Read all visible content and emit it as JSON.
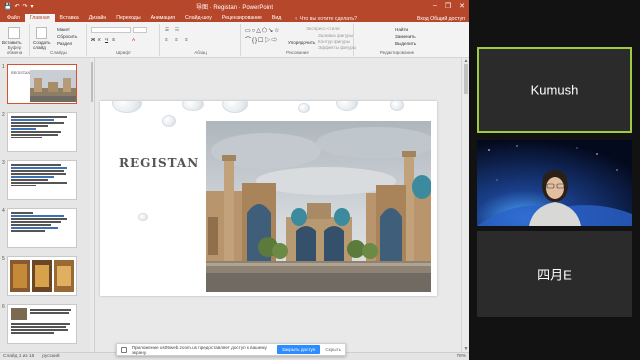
{
  "window": {
    "title": "导图 · Registan · PowerPoint",
    "minimize": "–",
    "maximize": "❐",
    "close": "✕"
  },
  "qat": [
    "💾",
    "↶",
    "↷",
    "▾"
  ],
  "tabs": [
    "Файл",
    "Главная",
    "Вставка",
    "Дизайн",
    "Переходы",
    "Анимация",
    "Слайд-шоу",
    "Рецензирование",
    "Вид"
  ],
  "active_tab": "Главная",
  "tell_me": "♀ Что вы хотите сделать?",
  "user": "Вход",
  "share_label": "Общий доступ",
  "ribbon": {
    "clipboard": {
      "paste": "Вставить",
      "label": "Буфер обмена"
    },
    "slides": {
      "create": "Создать слайд",
      "layout": "Макет",
      "reset": "Сбросить",
      "section": "Раздел",
      "label": "Слайды"
    },
    "font": {
      "label": "Шрифт"
    },
    "paragraph": {
      "label": "Абзац"
    },
    "drawing": {
      "arrange": "Упорядочить",
      "styles": "Экспресс-стили",
      "fill": "Заливка фигуры",
      "outline": "Контур фигуры",
      "effects": "Эффекты фигуры",
      "label": "Рисование"
    },
    "editing": {
      "find": "Найти",
      "replace": "Заменить",
      "select": "Выделить",
      "label": "Редактирование"
    }
  },
  "thumbnails": [
    {
      "num": "1",
      "title": "REGISTAN"
    },
    {
      "num": "2"
    },
    {
      "num": "3"
    },
    {
      "num": "4"
    },
    {
      "num": "5"
    },
    {
      "num": "6"
    }
  ],
  "slide": {
    "title": "REGISTAN"
  },
  "status": {
    "slide": "Слайд 1 из 16",
    "language": "русский",
    "zoom": "78%"
  },
  "share_notice": {
    "text": "Приложение us05web.zoom.us предоставляет доступ к вашему экрану.",
    "stop_label": "Закрыть доступ",
    "hide_label": "Скрыть"
  },
  "participants": [
    {
      "name": "Kumush",
      "active": true
    },
    {
      "name": "",
      "video": true
    },
    {
      "name": "四月E"
    }
  ],
  "colors": {
    "ppt_accent": "#b7472a",
    "speaker_border": "#9ccc42",
    "zoom_blue": "#2d8cff"
  }
}
